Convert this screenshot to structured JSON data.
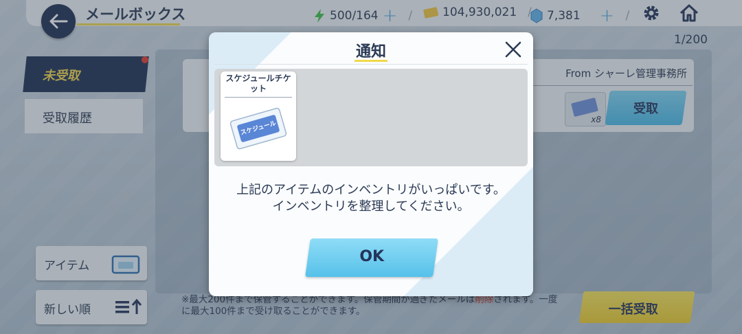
{
  "header": {
    "title": "メールボックス",
    "ap": "500/164",
    "credits": "104,930,021",
    "gems": "7,381"
  },
  "mail_count": "1/200",
  "tabs": {
    "unreceived": "未受取",
    "history": "受取履歴"
  },
  "side_buttons": {
    "item_filter": "アイテム",
    "sort": "新しい順"
  },
  "mail": {
    "from": "From シャーレ管理事務所",
    "receive_label": "受取",
    "item_count": "x8"
  },
  "note": {
    "part1": "※最大200件まで保管することができます。保管期間が過ぎたメールは",
    "highlight": "削除",
    "part2": "されます。一度に最大100件まで受け取ることができます。"
  },
  "bulk_receive": "一括受取",
  "dialog": {
    "title": "通知",
    "item_name": "スケジュールチケット",
    "ticket_text": "スケジュール",
    "message_line1": "上記のアイテムのインベントリがいっぱいです。",
    "message_line2": "インベントリを整理してください。",
    "ok_label": "OK"
  },
  "colors": {
    "navy": "#1e2f52",
    "accent_yellow": "#f1d94a",
    "button_blue": "#56c1ea",
    "alert_red": "#d03a2a"
  }
}
